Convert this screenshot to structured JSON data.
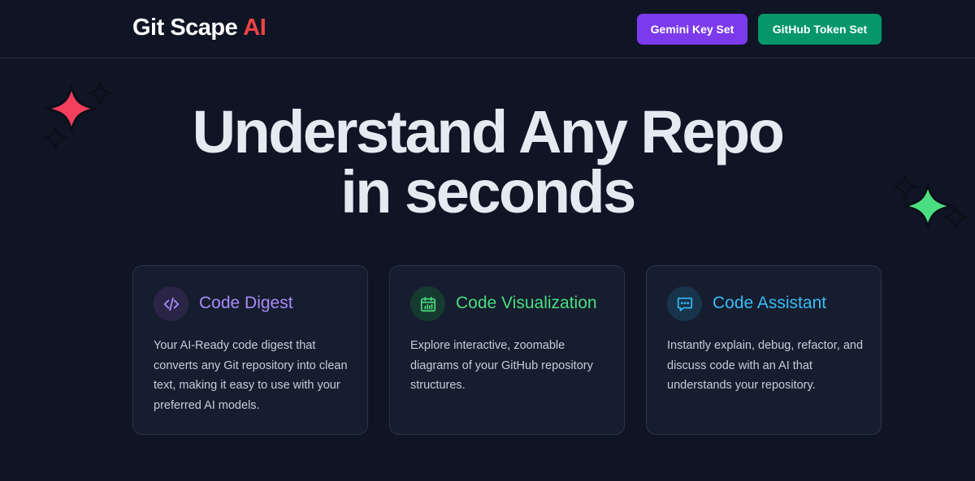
{
  "navbar": {
    "brand_main": "Git Scape",
    "brand_accent": "AI",
    "brand_accent_color": "#ef4444",
    "gemini_button": {
      "label": "Gemini Key Set",
      "color": "#7c3aed"
    },
    "github_button": {
      "label": "GitHub Token Set",
      "color": "#059669"
    }
  },
  "hero": {
    "line1": "Understand Any Repo",
    "line2": "in seconds"
  },
  "decorations": {
    "left_sparkle_color": "#f43f5e",
    "right_sparkle_color": "#4ade80"
  },
  "features": [
    {
      "icon": "code-brackets-icon",
      "title": "Code Digest",
      "title_color": "#a78bfa",
      "description": "Your AI-Ready code digest that converts any Git repository into clean text, making it easy to use with your preferred AI models."
    },
    {
      "icon": "calendar-chart-icon",
      "title": "Code Visualization",
      "title_color": "#4ade80",
      "description": "Explore interactive, zoomable diagrams of your GitHub repository structures."
    },
    {
      "icon": "chat-bubble-icon",
      "title": "Code Assistant",
      "title_color": "#38bdf8",
      "description": "Instantly explain, debug, refactor, and discuss code with an AI that understands your repository."
    }
  ]
}
